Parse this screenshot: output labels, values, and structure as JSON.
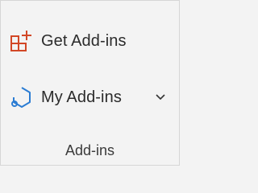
{
  "ribbon": {
    "group_label": "Add-ins",
    "commands": {
      "get_addins": {
        "label": "Get Add-ins",
        "icon": "store-grid-plus-icon"
      },
      "my_addins": {
        "label": "My Add-ins",
        "icon": "addin-hexagon-icon",
        "has_dropdown": true
      }
    }
  },
  "colors": {
    "get_addins_icon": "#d24726",
    "my_addins_icon": "#2b7cd3",
    "text": "#2b2b2b",
    "background": "#f3f3f3"
  }
}
